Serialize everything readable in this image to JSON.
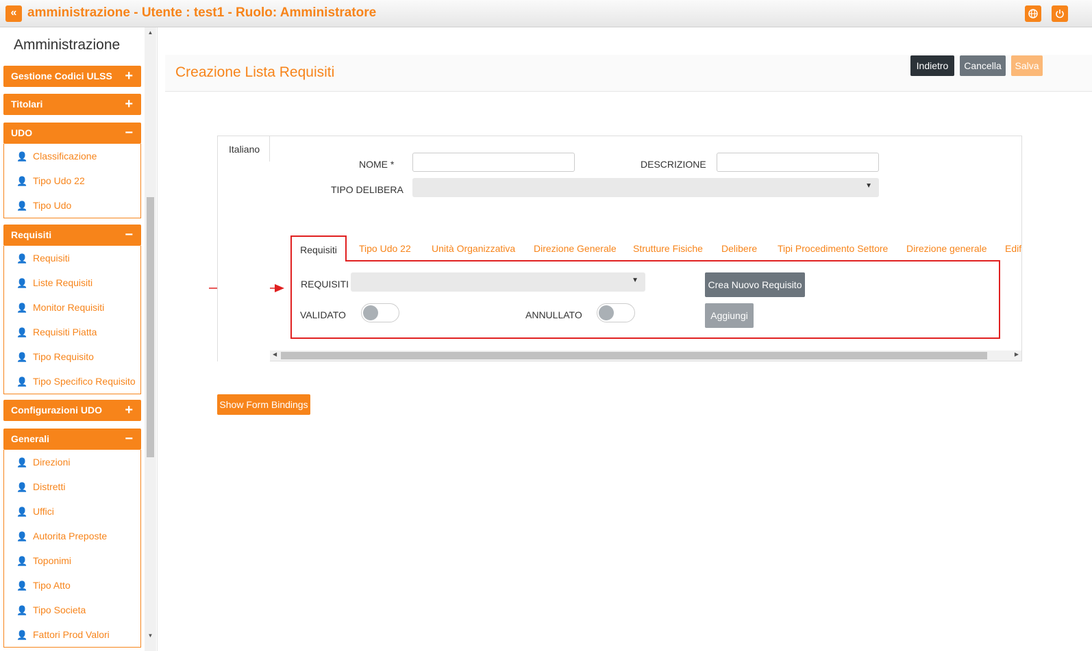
{
  "topbar": {
    "back_icon": "«",
    "title": "amministrazione - Utente : test1 - Ruolo: Amministratore",
    "globe_icon": "globe-icon",
    "power_icon": "power-icon"
  },
  "sidebar": {
    "title": "Amministrazione",
    "sections": [
      {
        "label": "Gestione Codici ULSS",
        "sign": "+"
      },
      {
        "label": "Titolari",
        "sign": "+"
      },
      {
        "label": "UDO",
        "sign": "−",
        "items": [
          "Classificazione",
          "Tipo Udo 22",
          "Tipo Udo"
        ]
      },
      {
        "label": "Requisiti",
        "sign": "−",
        "items": [
          "Requisiti",
          "Liste Requisiti",
          "Monitor Requisiti",
          "Requisiti Piatta",
          "Tipo Requisito",
          "Tipo Specifico Requisito"
        ]
      },
      {
        "label": "Configurazioni UDO",
        "sign": "+"
      },
      {
        "label": "Generali",
        "sign": "−",
        "items": [
          "Direzioni",
          "Distretti",
          "Uffici",
          "Autorita Preposte",
          "Toponimi",
          "Tipo Atto",
          "Tipo Societa",
          "Fattori Prod Valori"
        ]
      }
    ]
  },
  "header": {
    "title": "Creazione Lista Requisiti",
    "buttons": {
      "back": "Indietro",
      "cancel": "Cancella",
      "save": "Salva"
    }
  },
  "form": {
    "language_tab": "Italiano",
    "nome_label": "NOME *",
    "nome_value": "",
    "descrizione_label": "DESCRIZIONE",
    "descrizione_value": "",
    "tipo_delibera_label": "TIPO DELIBERA",
    "tipo_delibera_value": ""
  },
  "tabs": {
    "active": "Requisiti",
    "items": [
      "Tipo Udo 22",
      "Unità Organizzativa",
      "Direzione Generale",
      "Strutture Fisiche",
      "Delibere",
      "Tipi Procedimento Settore",
      "Direzione generale",
      "Edifi"
    ]
  },
  "requisiti_panel": {
    "requisiti_label": "REQUISITI",
    "requisiti_value": "",
    "validato_label": "VALIDATO",
    "validato_on": false,
    "annullato_label": "ANNULLATO",
    "annullato_on": false,
    "create_button": "Crea Nuovo Requisito",
    "add_button": "Aggiungi"
  },
  "show_bindings_button": "Show Form Bindings",
  "colors": {
    "accent": "#f7841a",
    "dark_button": "#2b3238",
    "gray_button": "#6c757d",
    "highlight": "#e02020"
  }
}
